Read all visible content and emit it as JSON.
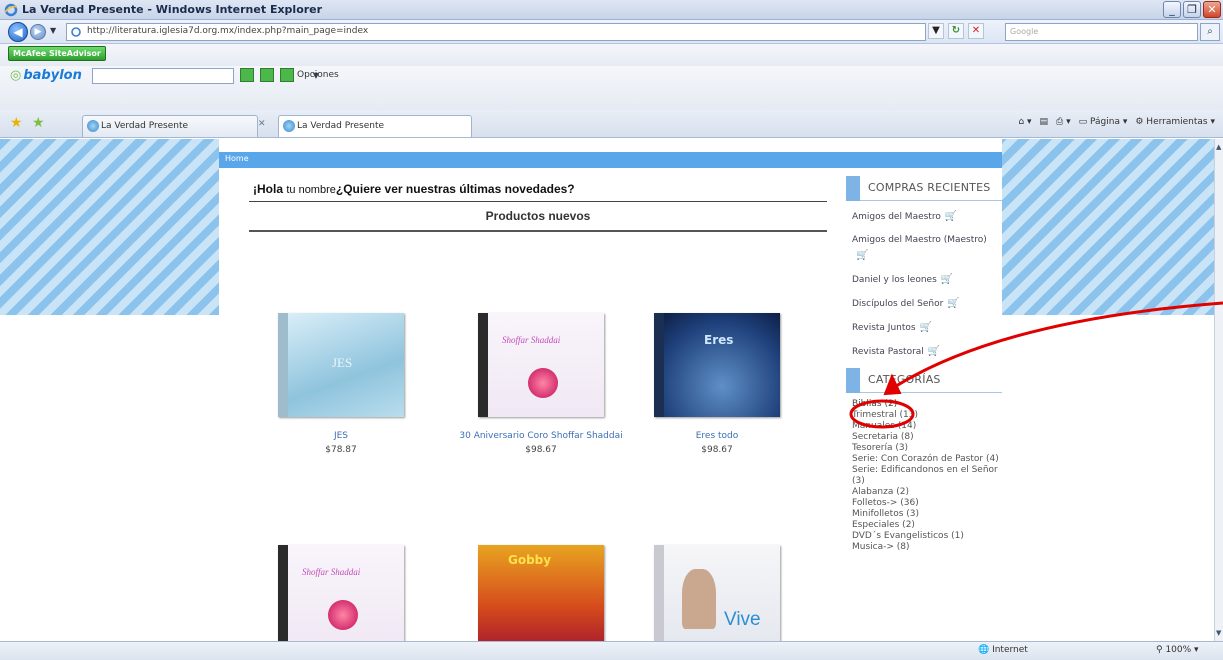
{
  "window": {
    "title": "La Verdad Presente - Windows Internet Explorer"
  },
  "address": {
    "url": "http://literatura.iglesia7d.org.mx/index.php?main_page=index",
    "search_placeholder": "Google"
  },
  "toolbars": {
    "mcafee_label": "McAfee SiteAdvisor",
    "babylon_label": "babylon",
    "opciones_label": "Opciones"
  },
  "tabs": [
    {
      "label": "La Verdad Presente"
    },
    {
      "label": "La Verdad Presente"
    }
  ],
  "command_bar": {
    "page_label": "Página",
    "tools_label": "Herramientas"
  },
  "site": {
    "home_label": "Home",
    "greeting_bold": "¡Hola",
    "greeting_name": "tu nombre",
    "greeting_question": "¿Quiere ver nuestras últimas novedades?",
    "products_title": "Productos nuevos",
    "products": [
      {
        "name": "JES",
        "price": "$78.87",
        "cover_text": "JES"
      },
      {
        "name": "30 Aniversario Coro Shoffar Shaddai",
        "price": "$98.67",
        "cover_text": "Shoffar Shaddai"
      },
      {
        "name": "Eres todo",
        "price": "$98.67",
        "cover_text": "Eres"
      },
      {
        "name": "",
        "price": "",
        "cover_text": "Shoffar Shaddai"
      },
      {
        "name": "",
        "price": "",
        "cover_text": "Gobby"
      },
      {
        "name": "",
        "price": "",
        "cover_text": "Vive"
      }
    ],
    "recent_title": "COMPRAS RECIENTES",
    "recent": [
      "Amigos del Maestro",
      "Amigos del Maestro (Maestro)",
      "Daniel y los leones",
      "Discípulos del Señor",
      "Revista Juntos",
      "Revista Pastoral"
    ],
    "categories_title": "CATEGORÍAS",
    "categories": [
      "Biblias (2)",
      "Trimestral (13)",
      "Manuales (14)",
      "Secretaria (8)",
      "Tesorería (3)",
      "Serie: Con Corazón de Pastor (4)",
      "Serie: Edificandonos en el Señor (3)",
      "Alabanza (2)",
      "Folletos-> (36)",
      "Minifolletos (3)",
      "Especiales (2)",
      "DVD´s Evangelisticos (1)",
      "Musica-> (8)"
    ]
  },
  "status": {
    "zone": "Internet",
    "zoom": "100%"
  },
  "colors": {
    "accent_blue": "#5aa6ea",
    "annotation_red": "#e00000",
    "link_blue": "#3b6fb5"
  }
}
